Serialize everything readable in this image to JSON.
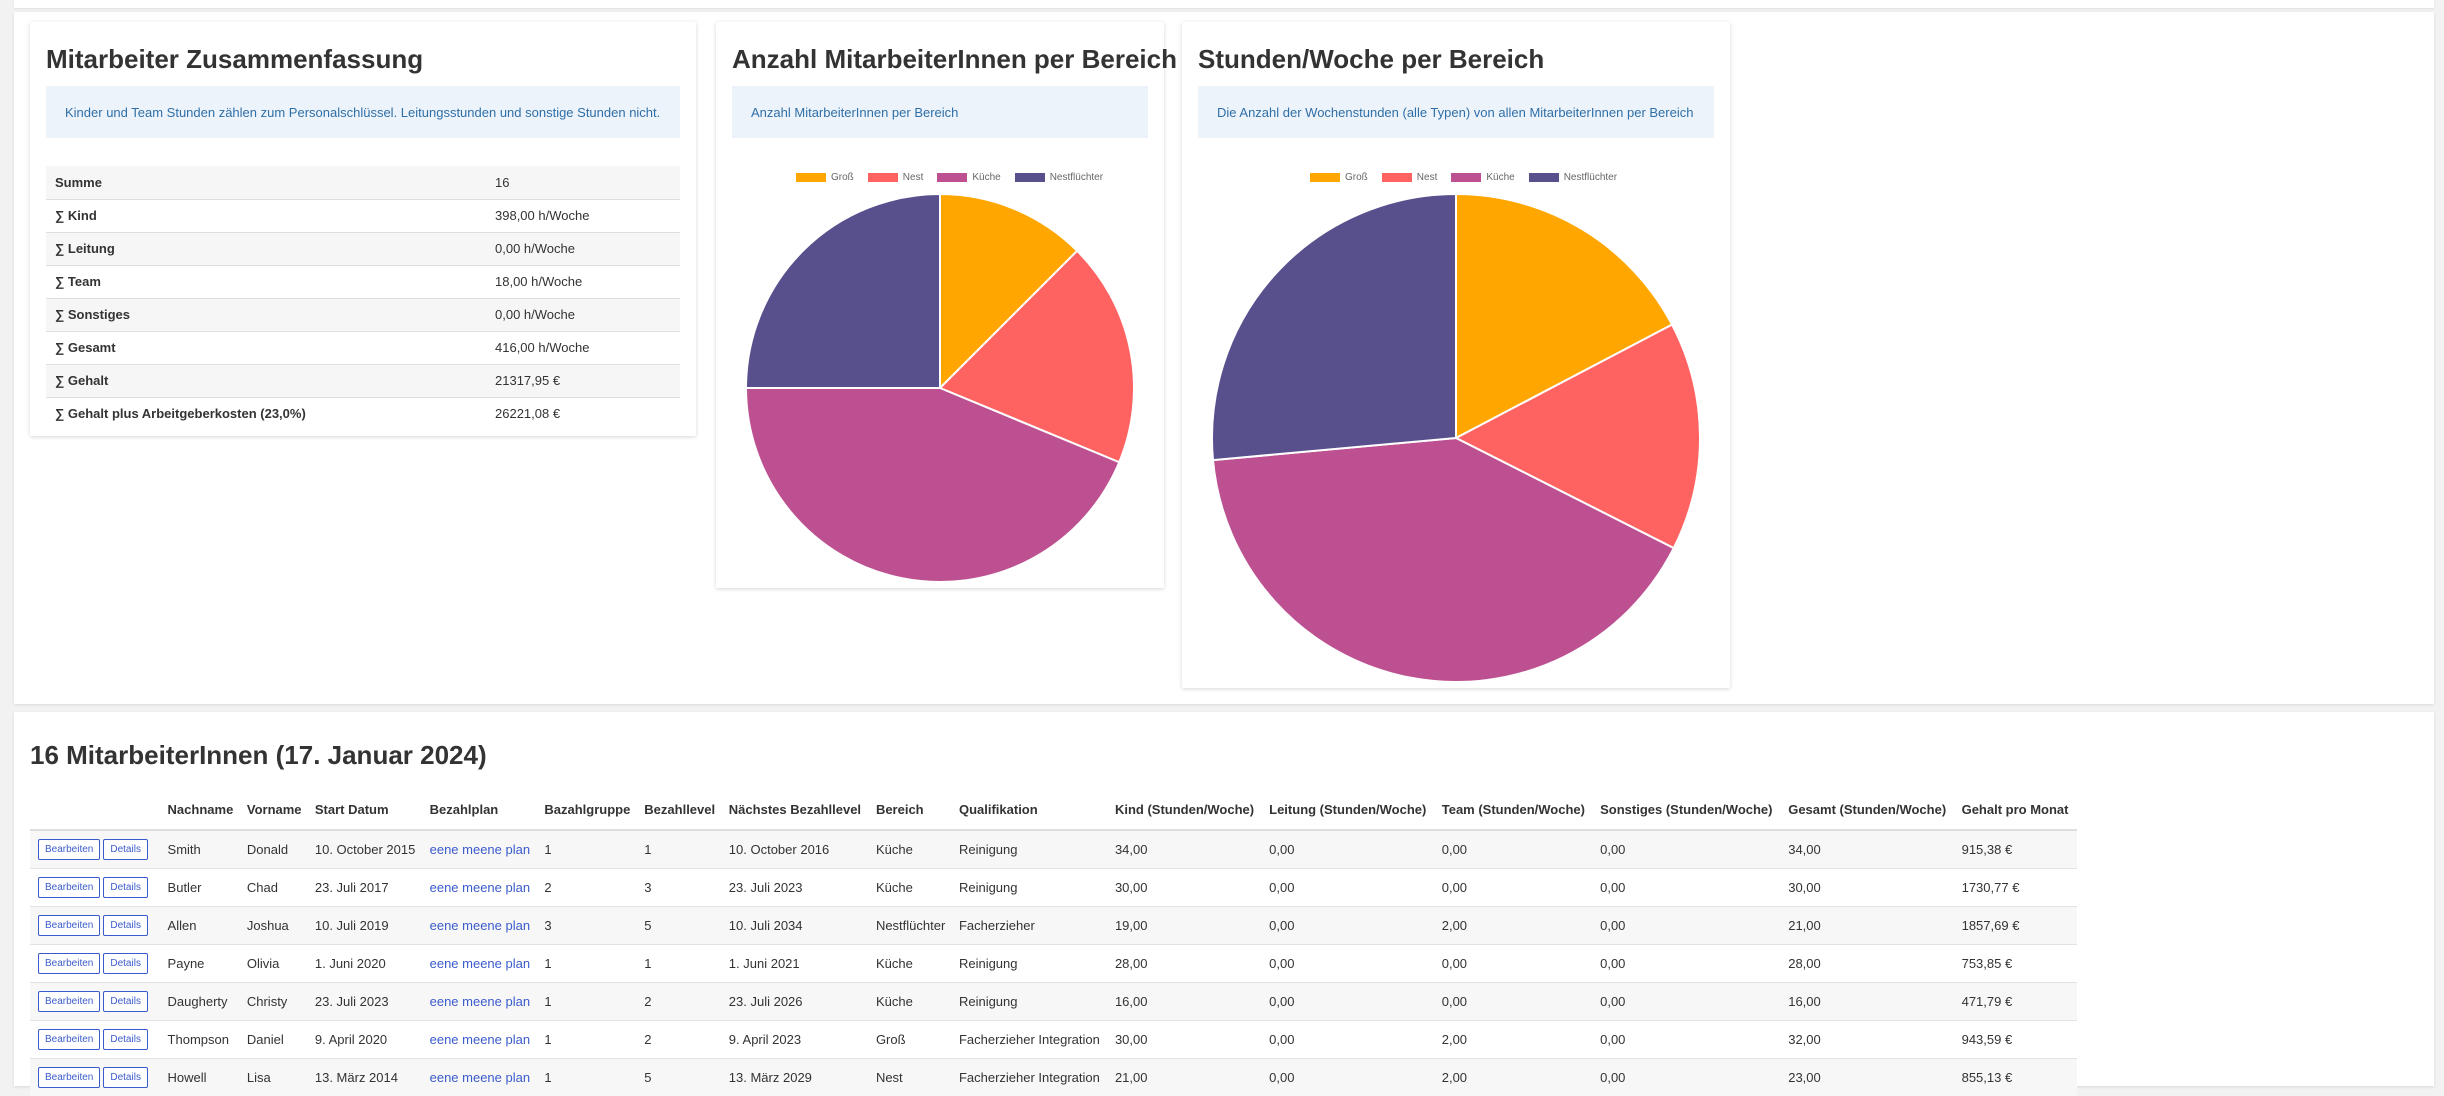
{
  "summary": {
    "title": "Mitarbeiter Zusammenfassung",
    "info": "Kinder und Team Stunden zählen zum Personalschlüssel. Leitungsstunden und sonstige Stunden nicht.",
    "rows": [
      {
        "label": "Summe",
        "value": "16"
      },
      {
        "label": "∑ Kind",
        "value": "398,00 h/Woche"
      },
      {
        "label": "∑ Leitung",
        "value": "0,00 h/Woche"
      },
      {
        "label": "∑ Team",
        "value": "18,00 h/Woche"
      },
      {
        "label": "∑ Sonstiges",
        "value": "0,00 h/Woche"
      },
      {
        "label": "∑ Gesamt",
        "value": "416,00 h/Woche"
      },
      {
        "label": "∑ Gehalt",
        "value": "21317,95 €"
      },
      {
        "label": "∑ Gehalt plus Arbeitgeberkosten (23,0%)",
        "value": "26221,08 €"
      }
    ]
  },
  "chart1": {
    "title": "Anzahl MitarbeiterInnen per Bereich",
    "info": "Anzahl MitarbeiterInnen per Bereich"
  },
  "chart2": {
    "title": "Stunden/Woche per Bereich",
    "info": "Die Anzahl der Wochenstunden (alle Typen) von allen MitarbeiterInnen per Bereich"
  },
  "chart_data": [
    {
      "type": "pie",
      "title": "Anzahl MitarbeiterInnen per Bereich",
      "categories": [
        "Groß",
        "Nest",
        "Küche",
        "Nestflüchter"
      ],
      "values": [
        2,
        3,
        7,
        4
      ],
      "colors": [
        "#ffa600",
        "#ff6361",
        "#bc5090",
        "#58508d"
      ],
      "legend": "top"
    },
    {
      "type": "pie",
      "title": "Stunden/Woche per Bereich",
      "categories": [
        "Groß",
        "Nest",
        "Küche",
        "Nestflüchter"
      ],
      "values": [
        72,
        63,
        171,
        110
      ],
      "colors": [
        "#ffa600",
        "#ff6361",
        "#bc5090",
        "#58508d"
      ],
      "legend": "top"
    }
  ],
  "employees": {
    "title": "16 MitarbeiterInnen (17. Januar 2024)",
    "edit_label": "Bearbeiten",
    "details_label": "Details",
    "columns": [
      "",
      "Nachname",
      "Vorname",
      "Start Datum",
      "Bezahlplan",
      "Bazahlgruppe",
      "Bezahllevel",
      "Nächstes Bezahllevel",
      "Bereich",
      "Qualifikation",
      "Kind (Stunden/Woche)",
      "Leitung (Stunden/Woche)",
      "Team (Stunden/Woche)",
      "Sonstiges (Stunden/Woche)",
      "Gesamt (Stunden/Woche)",
      "Gehalt pro Monat"
    ],
    "rows": [
      [
        "Smith",
        "Donald",
        "10. October 2015",
        "eene meene plan",
        "1",
        "1",
        "10. October 2016",
        "Küche",
        "Reinigung",
        "34,00",
        "0,00",
        "0,00",
        "0,00",
        "34,00",
        "915,38 €"
      ],
      [
        "Butler",
        "Chad",
        "23. Juli 2017",
        "eene meene plan",
        "2",
        "3",
        "23. Juli 2023",
        "Küche",
        "Reinigung",
        "30,00",
        "0,00",
        "0,00",
        "0,00",
        "30,00",
        "1730,77 €"
      ],
      [
        "Allen",
        "Joshua",
        "10. Juli 2019",
        "eene meene plan",
        "3",
        "5",
        "10. Juli 2034",
        "Nestflüchter",
        "Facherzieher",
        "19,00",
        "0,00",
        "2,00",
        "0,00",
        "21,00",
        "1857,69 €"
      ],
      [
        "Payne",
        "Olivia",
        "1. Juni 2020",
        "eene meene plan",
        "1",
        "1",
        "1. Juni 2021",
        "Küche",
        "Reinigung",
        "28,00",
        "0,00",
        "0,00",
        "0,00",
        "28,00",
        "753,85 €"
      ],
      [
        "Daugherty",
        "Christy",
        "23. Juli 2023",
        "eene meene plan",
        "1",
        "2",
        "23. Juli 2026",
        "Küche",
        "Reinigung",
        "16,00",
        "0,00",
        "0,00",
        "0,00",
        "16,00",
        "471,79 €"
      ],
      [
        "Thompson",
        "Daniel",
        "9. April 2020",
        "eene meene plan",
        "1",
        "2",
        "9. April 2023",
        "Groß",
        "Facherzieher Integration",
        "30,00",
        "0,00",
        "2,00",
        "0,00",
        "32,00",
        "943,59 €"
      ],
      [
        "Howell",
        "Lisa",
        "13. März 2014",
        "eene meene plan",
        "1",
        "5",
        "13. März 2029",
        "Nest",
        "Facherzieher Integration",
        "21,00",
        "0,00",
        "2,00",
        "0,00",
        "23,00",
        "855,13 €"
      ]
    ]
  }
}
